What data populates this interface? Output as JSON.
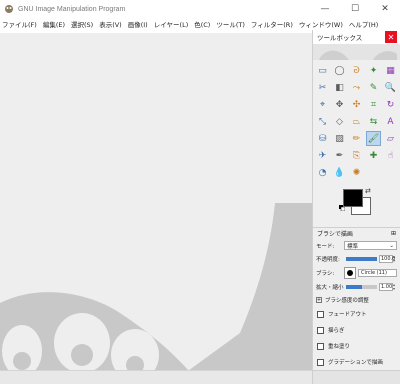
{
  "window": {
    "title": "GNU Image Manipulation Program",
    "minimize": "—",
    "maximize": "☐",
    "close": "✕"
  },
  "menubar": {
    "items": [
      "ファイル(F)",
      "編集(E)",
      "選択(S)",
      "表示(V)",
      "画像(I)",
      "レイヤー(L)",
      "色(C)",
      "ツール(T)",
      "フィルター(R)",
      "ウィンドウ(W)",
      "ヘルプ(H)"
    ]
  },
  "toolbox": {
    "title": "ツールボックス",
    "close": "✕",
    "tools": [
      {
        "name": "rect-select",
        "glyph": "▭"
      },
      {
        "name": "ellipse-select",
        "glyph": "◯"
      },
      {
        "name": "free-select",
        "glyph": "ᘐ"
      },
      {
        "name": "fuzzy-select",
        "glyph": "✦"
      },
      {
        "name": "color-select",
        "glyph": "▦"
      },
      {
        "name": "scissors",
        "glyph": "✂"
      },
      {
        "name": "foreground-select",
        "glyph": "◧"
      },
      {
        "name": "paths",
        "glyph": "⤳"
      },
      {
        "name": "color-picker",
        "glyph": "✎"
      },
      {
        "name": "zoom",
        "glyph": "🔍"
      },
      {
        "name": "measure",
        "glyph": "⌖"
      },
      {
        "name": "move",
        "glyph": "✥"
      },
      {
        "name": "align",
        "glyph": "✣"
      },
      {
        "name": "crop",
        "glyph": "⌗"
      },
      {
        "name": "rotate",
        "glyph": "↻"
      },
      {
        "name": "scale",
        "glyph": "⤡"
      },
      {
        "name": "shear",
        "glyph": "◇"
      },
      {
        "name": "perspective",
        "glyph": "⏢"
      },
      {
        "name": "flip",
        "glyph": "⇆"
      },
      {
        "name": "text",
        "glyph": "A"
      },
      {
        "name": "bucket-fill",
        "glyph": "⛁"
      },
      {
        "name": "blend",
        "glyph": "▨"
      },
      {
        "name": "pencil",
        "glyph": "✏"
      },
      {
        "name": "paintbrush",
        "glyph": "🖌"
      },
      {
        "name": "eraser",
        "glyph": "▱"
      },
      {
        "name": "airbrush",
        "glyph": "✈"
      },
      {
        "name": "ink",
        "glyph": "✒"
      },
      {
        "name": "clone",
        "glyph": "⎘"
      },
      {
        "name": "heal",
        "glyph": "✚"
      },
      {
        "name": "smudge",
        "glyph": "☝"
      },
      {
        "name": "dodge-burn",
        "glyph": "◔"
      },
      {
        "name": "blur-sharpen",
        "glyph": "💧"
      },
      {
        "name": "warp",
        "glyph": "✺"
      }
    ],
    "active_tool": "paintbrush",
    "fg_color": "#000000",
    "bg_color": "#ffffff"
  },
  "tool_options": {
    "title": "ブラシで描画",
    "mode_label": "モード:",
    "mode_value": "標準",
    "opacity_label": "不透明度:",
    "opacity_value": "100.0",
    "opacity_fraction": 1.0,
    "brush_label": "ブラシ:",
    "brush_value": "Circle (11)",
    "size_label": "拡大・縮小:",
    "size_value": "1.00",
    "size_fraction": 0.5,
    "dynamics_label": "ブラシ感度の調整",
    "checks": [
      "フェードアウト",
      "揺らぎ",
      "重ね塗り",
      "グラデーションで描画"
    ]
  }
}
